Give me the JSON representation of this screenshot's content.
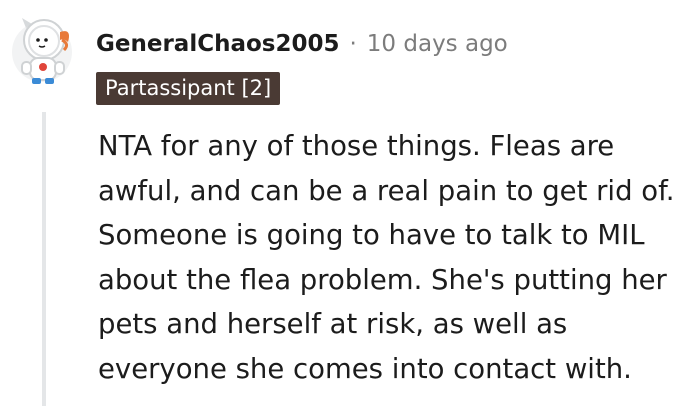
{
  "comment": {
    "username": "GeneralChaos2005",
    "separator": "·",
    "timestamp": "10 days ago",
    "flair": "Partassipant [2]",
    "body_lines": [
      "NTA for any of those things. Fleas are",
      "awful, and can be a real pain to get rid of.",
      "Someone is going to have to talk to MIL",
      "about the flea problem. She's putting her",
      "pets and herself at risk, as well as",
      "everyone she comes into contact with."
    ]
  },
  "colors": {
    "username": "#1c1c1c",
    "meta": "#7c7c7c",
    "flair_bg": "#4a3a34",
    "flair_text": "#ffffff",
    "thread_line": "#e4e6e8"
  },
  "icons": {
    "avatar": "astronaut-avatar-icon"
  }
}
